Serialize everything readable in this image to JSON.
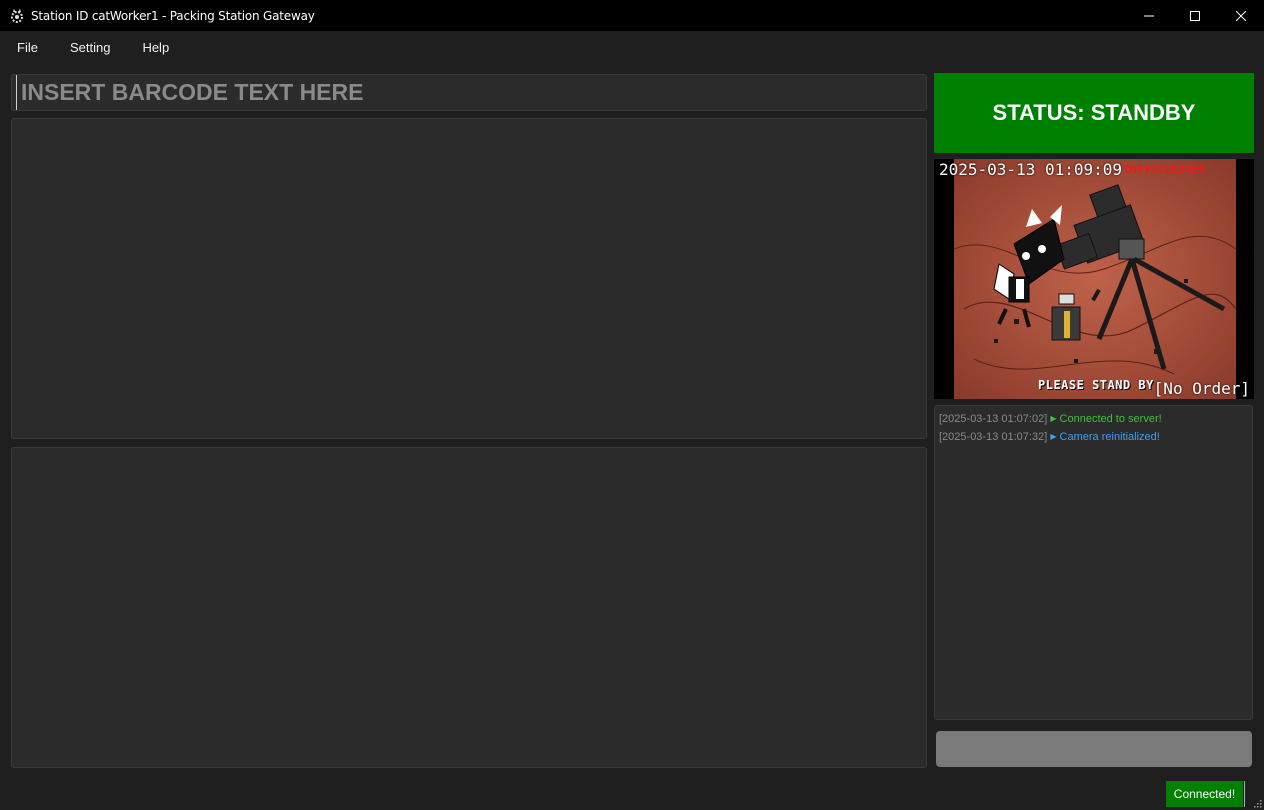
{
  "window": {
    "title": "Station ID catWorker1 - Packing Station Gateway"
  },
  "menu": {
    "items": [
      "File",
      "Setting",
      "Help"
    ]
  },
  "barcode": {
    "placeholder": "INSERT BARCODE TEXT HERE",
    "value": ""
  },
  "status": {
    "text": "STATUS: STANDBY",
    "color": "#008000"
  },
  "camera": {
    "timestamp": "2025-03-13 01:09:09",
    "order": "[No Order]",
    "overlay_standby": "PLEASE STAND BY",
    "overlay_difficulties": "DIFFICULTIES"
  },
  "log": {
    "entries": [
      {
        "time": "[2025-03-13 01:07:02]",
        "message": "Connected to server!",
        "color": "#3fbf3f"
      },
      {
        "time": "[2025-03-13 01:07:32]",
        "message": "Camera reinitialized!",
        "color": "#3a9ff5"
      }
    ]
  },
  "statusbar": {
    "connection": "Connected!",
    "connection_color": "#008000"
  },
  "icons": {
    "app": "gear-cat-icon",
    "minimize": "minimize-icon",
    "maximize": "maximize-icon",
    "close": "close-icon"
  }
}
